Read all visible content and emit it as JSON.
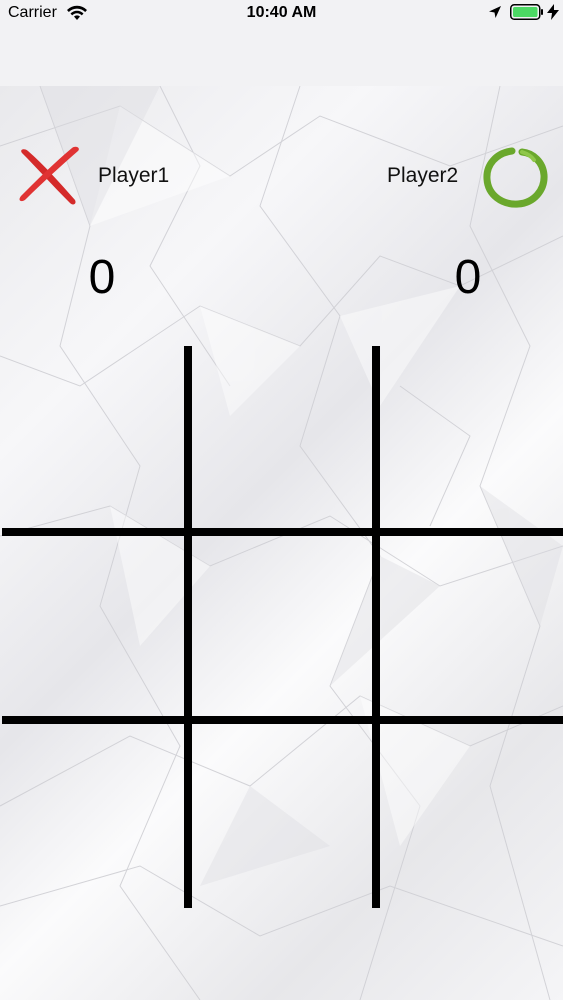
{
  "status": {
    "carrier": "Carrier",
    "time": "10:40 AM"
  },
  "players": [
    {
      "label": "Player1",
      "score": "0",
      "icon": "x-mark-icon",
      "color": "#d42a2a"
    },
    {
      "label": "Player2",
      "score": "0",
      "icon": "o-ring-icon",
      "color": "#6aa82c"
    }
  ],
  "board": {
    "rows": 3,
    "cols": 3,
    "cells": [
      "",
      "",
      "",
      "",
      "",
      "",
      "",
      "",
      ""
    ]
  },
  "colors": {
    "grid": "#000000",
    "battery": "#4cd964"
  }
}
